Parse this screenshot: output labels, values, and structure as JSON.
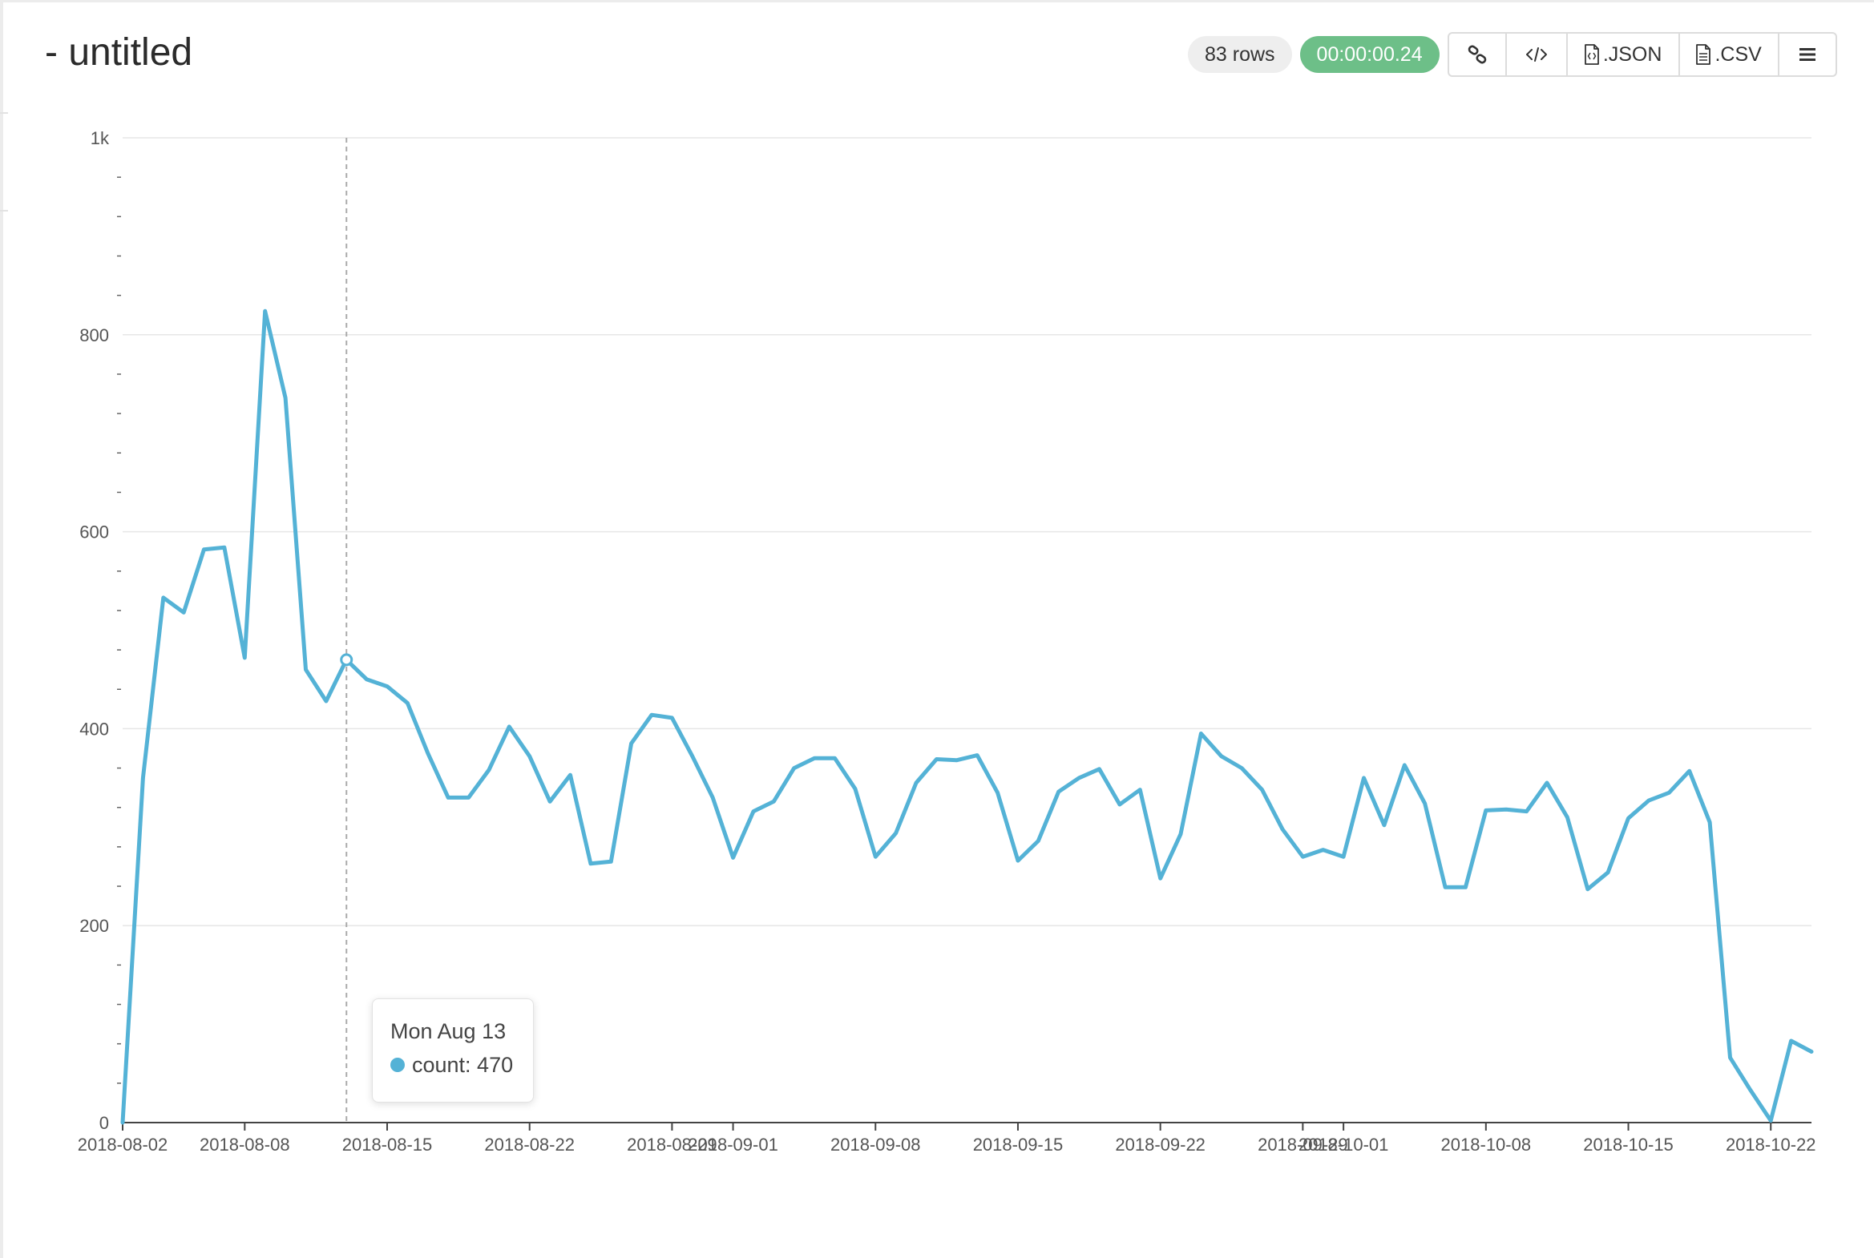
{
  "header": {
    "title": "- untitled",
    "rows_badge": "83 rows",
    "time_badge": "00:00:00.24",
    "json_label": ".JSON",
    "csv_label": ".CSV"
  },
  "icons": [
    "link-icon",
    "code-icon",
    "json-file-icon",
    "csv-file-icon",
    "hamburger-menu-icon"
  ],
  "colors": {
    "series": "#54b2d6",
    "time_badge": "#6dbf88",
    "grid": "#e6e6e6",
    "crosshair": "#aaaaaa"
  },
  "tooltip": {
    "date": "Mon Aug 13",
    "series_label": "count: 470"
  },
  "chart_data": {
    "type": "line",
    "title": "",
    "xlabel": "",
    "ylabel": "",
    "ylim": [
      0,
      1000
    ],
    "y_ticks": [
      {
        "value": 0,
        "label": "0"
      },
      {
        "value": 200,
        "label": "200"
      },
      {
        "value": 400,
        "label": "400"
      },
      {
        "value": 600,
        "label": "600"
      },
      {
        "value": 800,
        "label": "800"
      },
      {
        "value": 1000,
        "label": "1k"
      }
    ],
    "x_range": [
      "2018-08-02",
      "2018-10-24"
    ],
    "x_ticks": [
      "2018-08-02",
      "2018-08-08",
      "2018-08-15",
      "2018-08-22",
      "2018-08-29",
      "2018-09-01",
      "2018-09-08",
      "2018-09-15",
      "2018-09-22",
      "2018-09-29",
      "2018-10-01",
      "2018-10-08",
      "2018-10-15",
      "2018-10-22"
    ],
    "grid": true,
    "legend": "none",
    "highlighted_point": {
      "x": "2018-08-13",
      "y": 470
    },
    "series": [
      {
        "x": [
          "2018-08-02",
          "2018-08-03",
          "2018-08-04",
          "2018-08-05",
          "2018-08-06",
          "2018-08-07",
          "2018-08-08",
          "2018-08-09",
          "2018-08-10",
          "2018-08-11",
          "2018-08-12",
          "2018-08-13",
          "2018-08-14",
          "2018-08-15",
          "2018-08-16",
          "2018-08-17",
          "2018-08-18",
          "2018-08-19",
          "2018-08-20",
          "2018-08-21",
          "2018-08-22",
          "2018-08-23",
          "2018-08-24",
          "2018-08-25",
          "2018-08-26",
          "2018-08-27",
          "2018-08-28",
          "2018-08-29",
          "2018-08-30",
          "2018-08-31",
          "2018-09-01",
          "2018-09-02",
          "2018-09-03",
          "2018-09-04",
          "2018-09-05",
          "2018-09-06",
          "2018-09-07",
          "2018-09-08",
          "2018-09-09",
          "2018-09-10",
          "2018-09-11",
          "2018-09-12",
          "2018-09-13",
          "2018-09-14",
          "2018-09-15",
          "2018-09-16",
          "2018-09-17",
          "2018-09-18",
          "2018-09-19",
          "2018-09-20",
          "2018-09-21",
          "2018-09-22",
          "2018-09-23",
          "2018-09-24",
          "2018-09-25",
          "2018-09-26",
          "2018-09-27",
          "2018-09-28",
          "2018-09-29",
          "2018-09-30",
          "2018-10-01",
          "2018-10-02",
          "2018-10-03",
          "2018-10-04",
          "2018-10-05",
          "2018-10-06",
          "2018-10-07",
          "2018-10-08",
          "2018-10-09",
          "2018-10-10",
          "2018-10-11",
          "2018-10-12",
          "2018-10-13",
          "2018-10-14",
          "2018-10-15",
          "2018-10-16",
          "2018-10-17",
          "2018-10-18",
          "2018-10-19",
          "2018-10-20",
          "2018-10-21",
          "2018-10-22",
          "2018-10-23",
          "2018-10-24"
        ],
        "values": [
          0,
          350,
          533,
          518,
          582,
          584,
          472,
          824,
          736,
          460,
          428,
          470,
          450,
          443,
          426,
          375,
          330,
          330,
          358,
          402,
          372,
          326,
          353,
          263,
          265,
          385,
          414,
          411,
          372,
          330,
          269,
          316,
          326,
          360,
          370,
          370,
          339,
          270,
          294,
          345,
          369,
          368,
          373,
          335,
          266,
          286,
          336,
          350,
          359,
          323,
          338,
          248,
          293,
          395,
          372,
          360,
          338,
          298,
          270,
          277,
          270,
          350,
          302,
          363,
          324,
          239,
          239,
          317,
          318,
          316,
          345,
          310,
          237,
          254,
          309,
          327,
          335,
          357,
          305,
          66,
          33,
          2,
          83,
          72
        ]
      }
    ]
  }
}
